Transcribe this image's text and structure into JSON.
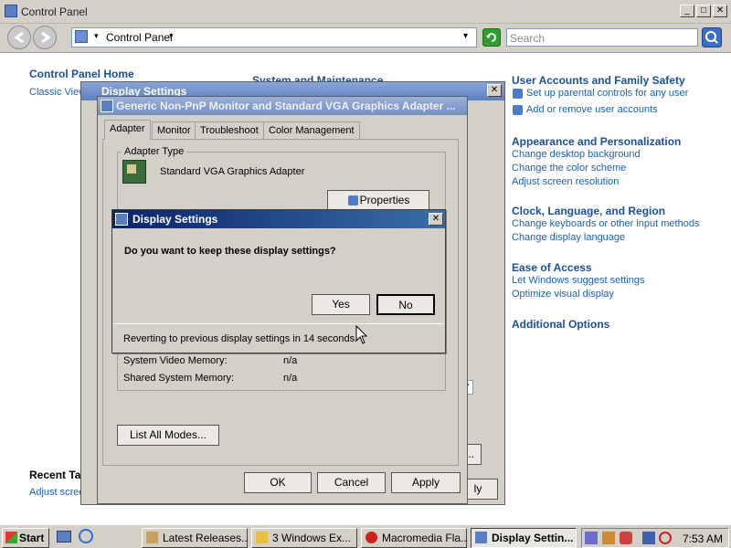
{
  "control_panel": {
    "title": "Control Panel",
    "address": "Control Panel",
    "search_placeholder": "Search",
    "sidebar": {
      "home": "Control Panel Home",
      "classic_view": "Classic View",
      "recent_tasks": "Recent Tasks",
      "recent_link": "Adjust screen resolution"
    },
    "center_heading": "System and Maintenance",
    "categories": [
      {
        "heading": "User Accounts and Family Safety",
        "links": [
          "Set up parental controls for any user",
          "Add or remove user accounts"
        ]
      },
      {
        "heading": "Appearance and Personalization",
        "links": [
          "Change desktop background",
          "Change the color scheme",
          "Adjust screen resolution"
        ]
      },
      {
        "heading": "Clock, Language, and Region",
        "links": [
          "Change keyboards or other input methods",
          "Change display language"
        ]
      },
      {
        "heading": "Ease of Access",
        "links": [
          "Let Windows suggest settings",
          "Optimize visual display"
        ]
      },
      {
        "heading": "Additional Options",
        "links": []
      }
    ]
  },
  "display_settings": {
    "title": "Display Settings"
  },
  "adapter_props": {
    "title": "Generic Non-PnP Monitor and Standard VGA Graphics Adapter ...",
    "tabs": [
      "Adapter",
      "Monitor",
      "Troubleshoot",
      "Color Management"
    ],
    "adapter_type_label": "Adapter Type",
    "adapter_name": "Standard VGA Graphics Adapter",
    "properties_button": "Properties",
    "memory_rows": [
      {
        "label": "System Video Memory:",
        "value": "n/a"
      },
      {
        "label": "Shared System Memory:",
        "value": "n/a"
      }
    ],
    "list_modes_button": "List All Modes...",
    "ok": "OK",
    "cancel": "Cancel",
    "apply": "Apply"
  },
  "confirm": {
    "title": "Display Settings",
    "question": "Do you want to keep these display settings?",
    "yes": "Yes",
    "no": "No",
    "status": "Reverting to previous display settings in 14 seconds."
  },
  "taskbar": {
    "start": "Start",
    "buttons": [
      "Latest Releases...",
      "3 Windows Ex...",
      "Macromedia Fla...",
      "Display Settin..."
    ],
    "clock": "7:53 AM"
  }
}
